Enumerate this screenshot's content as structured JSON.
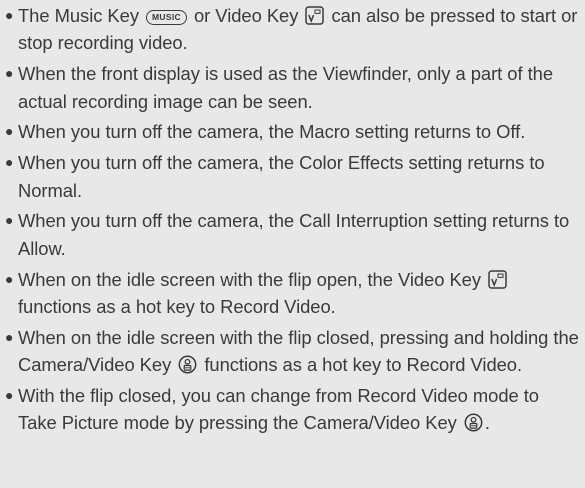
{
  "bullets": [
    {
      "before": "The Music Key ",
      "music_key_label": "MUSIC",
      "middle": " or Video Key ",
      "after": " can also be pressed to start or stop recording video."
    },
    {
      "text": "When the front display is used as the Viewfinder, only a part of the actual recording image can be seen."
    },
    {
      "text": "When you turn off the camera, the Macro setting returns to Off."
    },
    {
      "text": "When you turn off the camera, the Color Effects setting returns to Normal."
    },
    {
      "text": "When you turn off the camera, the Call Interruption setting returns to Allow."
    },
    {
      "before": "When on the idle screen with the flip open, the Video Key ",
      "after": " functions as a hot key to Record Video."
    },
    {
      "before": "When on the idle screen with the flip closed, pressing and holding the Camera/Video Key ",
      "after": " functions as a hot key to Record Video."
    },
    {
      "before": "With the flip closed, you can change from Record Video mode to Take Picture mode by pressing the Camera/Video Key ",
      "after": "."
    }
  ],
  "icons": {
    "video_key": "video-key-icon",
    "camera_video_key": "camera-video-key-icon",
    "music_key": "music-key-icon"
  },
  "colors": {
    "background": "#e8e8e8",
    "text": "#3a3a3a"
  }
}
